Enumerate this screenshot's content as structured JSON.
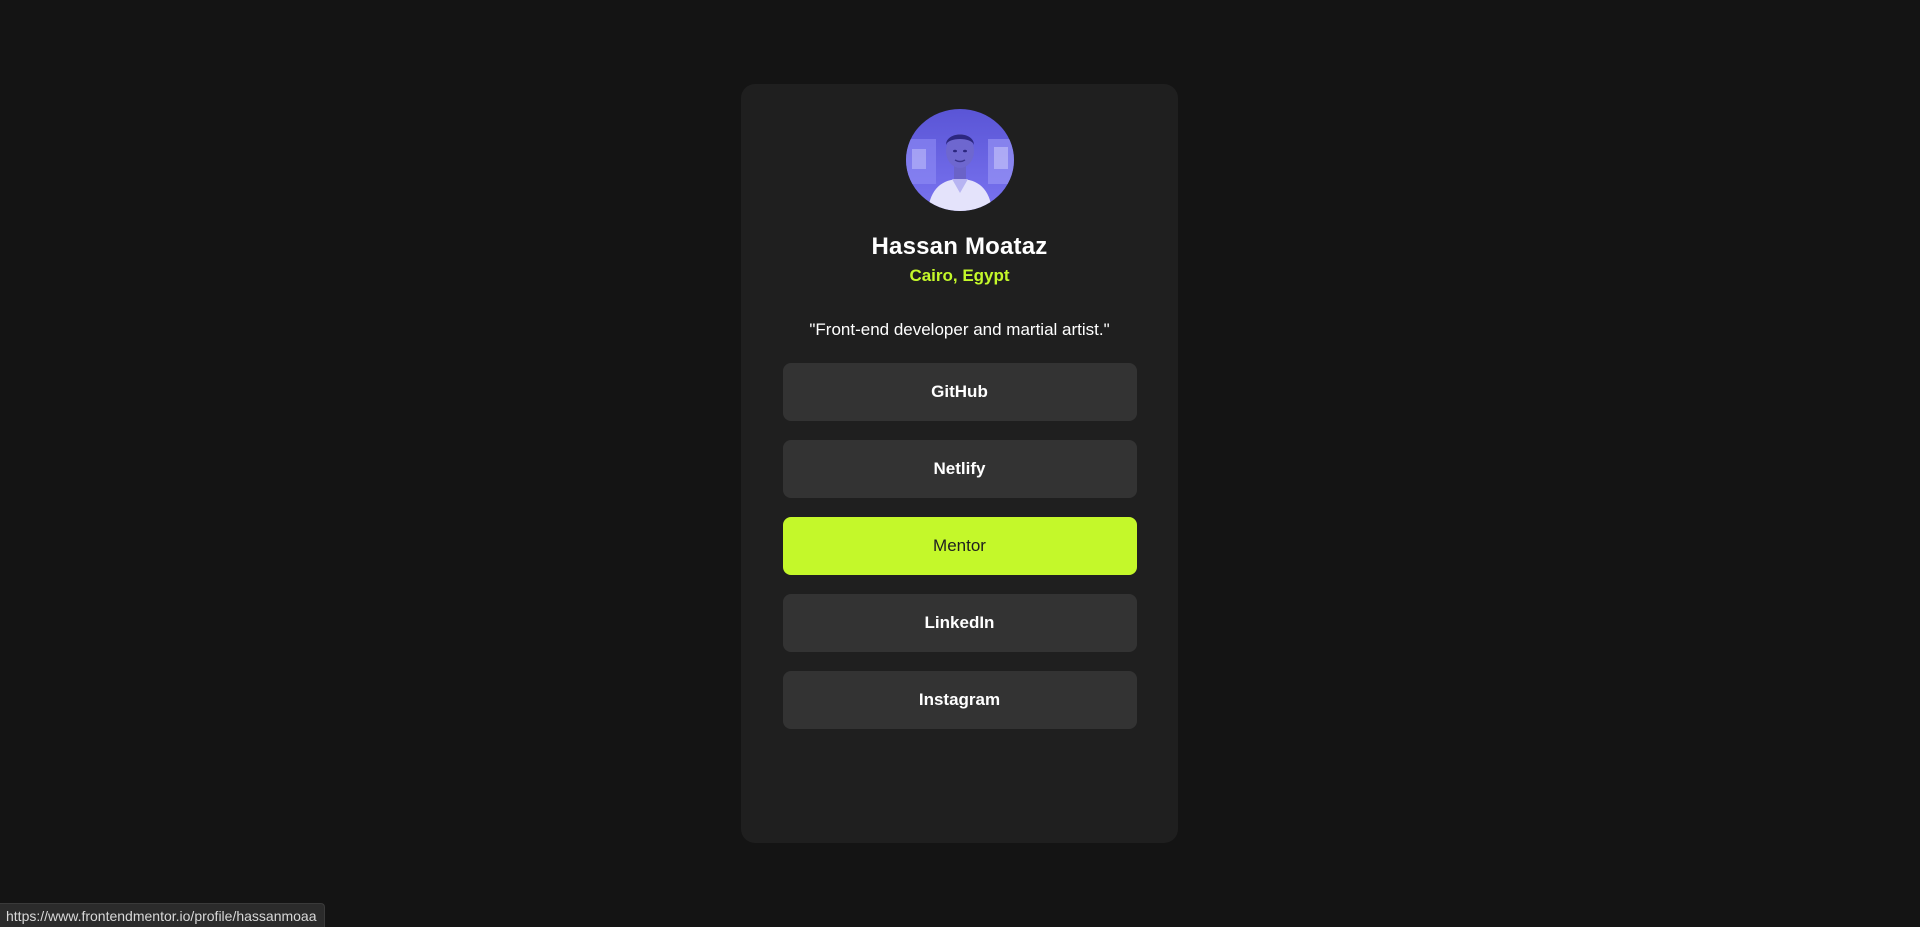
{
  "profile": {
    "avatar_icon": "profile-photo",
    "name": "Hassan Moataz",
    "location": "Cairo, Egypt",
    "bio": "\"Front-end developer and martial artist.\""
  },
  "links": [
    {
      "label": "GitHub",
      "active": false
    },
    {
      "label": "Netlify",
      "active": false
    },
    {
      "label": "Mentor",
      "active": true
    },
    {
      "label": "LinkedIn",
      "active": false
    },
    {
      "label": "Instagram",
      "active": false
    }
  ],
  "status_bar": {
    "url": "https://www.frontendmentor.io/profile/hassanmoaa"
  },
  "colors": {
    "page_background": "#141414",
    "card_background": "#1f1f1f",
    "button_background": "#333333",
    "accent": "#c4f82a",
    "text": "#ffffff"
  }
}
